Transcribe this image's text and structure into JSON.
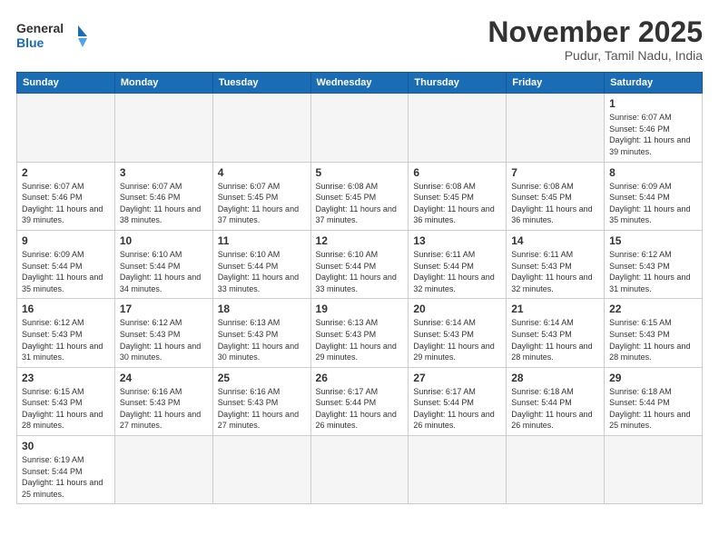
{
  "header": {
    "logo_general": "General",
    "logo_blue": "Blue",
    "month_title": "November 2025",
    "subtitle": "Pudur, Tamil Nadu, India"
  },
  "weekdays": [
    "Sunday",
    "Monday",
    "Tuesday",
    "Wednesday",
    "Thursday",
    "Friday",
    "Saturday"
  ],
  "weeks": [
    [
      {
        "day": "",
        "empty": true
      },
      {
        "day": "",
        "empty": true
      },
      {
        "day": "",
        "empty": true
      },
      {
        "day": "",
        "empty": true
      },
      {
        "day": "",
        "empty": true
      },
      {
        "day": "",
        "empty": true
      },
      {
        "day": "1",
        "sunrise": "6:07 AM",
        "sunset": "5:46 PM",
        "daylight": "11 hours and 39 minutes."
      }
    ],
    [
      {
        "day": "2",
        "sunrise": "6:07 AM",
        "sunset": "5:46 PM",
        "daylight": "11 hours and 39 minutes."
      },
      {
        "day": "3",
        "sunrise": "6:07 AM",
        "sunset": "5:46 PM",
        "daylight": "11 hours and 38 minutes."
      },
      {
        "day": "4",
        "sunrise": "6:07 AM",
        "sunset": "5:45 PM",
        "daylight": "11 hours and 37 minutes."
      },
      {
        "day": "5",
        "sunrise": "6:08 AM",
        "sunset": "5:45 PM",
        "daylight": "11 hours and 37 minutes."
      },
      {
        "day": "6",
        "sunrise": "6:08 AM",
        "sunset": "5:45 PM",
        "daylight": "11 hours and 36 minutes."
      },
      {
        "day": "7",
        "sunrise": "6:08 AM",
        "sunset": "5:45 PM",
        "daylight": "11 hours and 36 minutes."
      },
      {
        "day": "8",
        "sunrise": "6:09 AM",
        "sunset": "5:44 PM",
        "daylight": "11 hours and 35 minutes."
      }
    ],
    [
      {
        "day": "9",
        "sunrise": "6:09 AM",
        "sunset": "5:44 PM",
        "daylight": "11 hours and 35 minutes."
      },
      {
        "day": "10",
        "sunrise": "6:10 AM",
        "sunset": "5:44 PM",
        "daylight": "11 hours and 34 minutes."
      },
      {
        "day": "11",
        "sunrise": "6:10 AM",
        "sunset": "5:44 PM",
        "daylight": "11 hours and 33 minutes."
      },
      {
        "day": "12",
        "sunrise": "6:10 AM",
        "sunset": "5:44 PM",
        "daylight": "11 hours and 33 minutes."
      },
      {
        "day": "13",
        "sunrise": "6:11 AM",
        "sunset": "5:44 PM",
        "daylight": "11 hours and 32 minutes."
      },
      {
        "day": "14",
        "sunrise": "6:11 AM",
        "sunset": "5:43 PM",
        "daylight": "11 hours and 32 minutes."
      },
      {
        "day": "15",
        "sunrise": "6:12 AM",
        "sunset": "5:43 PM",
        "daylight": "11 hours and 31 minutes."
      }
    ],
    [
      {
        "day": "16",
        "sunrise": "6:12 AM",
        "sunset": "5:43 PM",
        "daylight": "11 hours and 31 minutes."
      },
      {
        "day": "17",
        "sunrise": "6:12 AM",
        "sunset": "5:43 PM",
        "daylight": "11 hours and 30 minutes."
      },
      {
        "day": "18",
        "sunrise": "6:13 AM",
        "sunset": "5:43 PM",
        "daylight": "11 hours and 30 minutes."
      },
      {
        "day": "19",
        "sunrise": "6:13 AM",
        "sunset": "5:43 PM",
        "daylight": "11 hours and 29 minutes."
      },
      {
        "day": "20",
        "sunrise": "6:14 AM",
        "sunset": "5:43 PM",
        "daylight": "11 hours and 29 minutes."
      },
      {
        "day": "21",
        "sunrise": "6:14 AM",
        "sunset": "5:43 PM",
        "daylight": "11 hours and 28 minutes."
      },
      {
        "day": "22",
        "sunrise": "6:15 AM",
        "sunset": "5:43 PM",
        "daylight": "11 hours and 28 minutes."
      }
    ],
    [
      {
        "day": "23",
        "sunrise": "6:15 AM",
        "sunset": "5:43 PM",
        "daylight": "11 hours and 28 minutes."
      },
      {
        "day": "24",
        "sunrise": "6:16 AM",
        "sunset": "5:43 PM",
        "daylight": "11 hours and 27 minutes."
      },
      {
        "day": "25",
        "sunrise": "6:16 AM",
        "sunset": "5:43 PM",
        "daylight": "11 hours and 27 minutes."
      },
      {
        "day": "26",
        "sunrise": "6:17 AM",
        "sunset": "5:44 PM",
        "daylight": "11 hours and 26 minutes."
      },
      {
        "day": "27",
        "sunrise": "6:17 AM",
        "sunset": "5:44 PM",
        "daylight": "11 hours and 26 minutes."
      },
      {
        "day": "28",
        "sunrise": "6:18 AM",
        "sunset": "5:44 PM",
        "daylight": "11 hours and 26 minutes."
      },
      {
        "day": "29",
        "sunrise": "6:18 AM",
        "sunset": "5:44 PM",
        "daylight": "11 hours and 25 minutes."
      }
    ],
    [
      {
        "day": "30",
        "sunrise": "6:19 AM",
        "sunset": "5:44 PM",
        "daylight": "11 hours and 25 minutes."
      },
      {
        "day": "",
        "empty": true
      },
      {
        "day": "",
        "empty": true
      },
      {
        "day": "",
        "empty": true
      },
      {
        "day": "",
        "empty": true
      },
      {
        "day": "",
        "empty": true
      },
      {
        "day": "",
        "empty": true
      }
    ]
  ],
  "labels": {
    "sunrise": "Sunrise:",
    "sunset": "Sunset:",
    "daylight": "Daylight"
  }
}
